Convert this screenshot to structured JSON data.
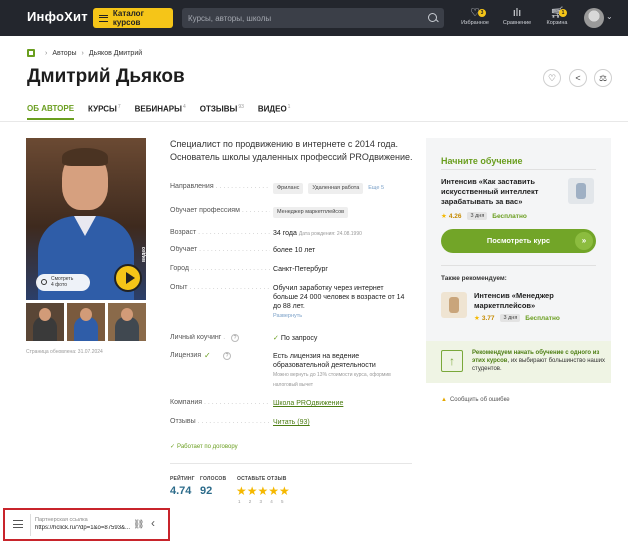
{
  "header": {
    "logo": "ИнфоХит",
    "catalog_label": "Каталог курсов",
    "search_placeholder": "Курсы, авторы, школы",
    "favorites": {
      "label": "Избранное",
      "count": "3"
    },
    "compare": {
      "label": "Сравнение"
    },
    "cart": {
      "label": "Корзина",
      "count": "1"
    }
  },
  "breadcrumb": {
    "items": [
      "Авторы",
      "Дьяков Дмитрий"
    ]
  },
  "page": {
    "title": "Дмитрий Дьяков",
    "tabs": [
      {
        "label": "ОБ АВТОРЕ",
        "count": ""
      },
      {
        "label": "КУРСЫ",
        "count": "7"
      },
      {
        "label": "ВЕБИНАРЫ",
        "count": "4"
      },
      {
        "label": "ОТЗЫВЫ",
        "count": "93"
      },
      {
        "label": "ВИДЕО",
        "count": "1"
      }
    ]
  },
  "profile": {
    "watch_photos": [
      "Смотреть",
      "4 фото"
    ],
    "video_label": "видео",
    "updated": "Страница обновлена: 31.07.2024",
    "intro": "Специалист по продвижению в интернете с 2014 года. Основатель школы удаленных профессий PROдвижение.",
    "fields": {
      "direction": {
        "label": "Направления",
        "chips": [
          "Фриланс",
          "Удаленная работа"
        ],
        "more": "Еще 5"
      },
      "teaches": {
        "label": "Обучает профессиям",
        "chips": [
          "Менеджер маркетплейсов"
        ]
      },
      "age": {
        "label": "Возраст",
        "value": "34 года",
        "note": "Дата рождения: 24.08.1990"
      },
      "teaching": {
        "label": "Обучает",
        "value": "более 10 лет"
      },
      "city": {
        "label": "Город",
        "value": "Санкт-Петербург"
      },
      "experience": {
        "label": "Опыт",
        "lines": [
          "Обучил заработку через интернет",
          "больше 24 000 человек в возрасте от 14",
          "до 88 лет."
        ],
        "expand": "Развернуть"
      },
      "coaching": {
        "label": "Личный коучинг",
        "q": "?",
        "value": "По запросу"
      },
      "license": {
        "label": "Лицензия",
        "q": "?",
        "lines": [
          "Есть лицензия на ведение",
          "образовательной деятельности"
        ],
        "notes": [
          "Можно вернуть до 13% стоимости курса, оформив",
          "налоговый вычет"
        ]
      },
      "company": {
        "label": "Компания",
        "value": "Школа PROдвижение"
      },
      "reviews": {
        "label": "Отзывы",
        "value": "Читать (93)"
      }
    },
    "contract": "Работает по договору",
    "stats": {
      "rating_label": "РЕЙТИНГ",
      "rating": "4.74",
      "votes_label": "ГОЛОСОВ",
      "votes": "92",
      "leave_label": "ОСТАВЬТЕ ОТЗЫВ",
      "stars": "★★★★★",
      "star_numbers": "1 2 3 4 5"
    }
  },
  "sidebar": {
    "heading": "Начните обучение",
    "course1": {
      "lines": [
        "Интенсив «Как заставить",
        "искусственный интеллект",
        "зарабатывать за вас»"
      ],
      "rating": "4.26",
      "duration": "3 дня",
      "price": "Бесплатно"
    },
    "cta": "Посмотреть курс",
    "also_label": "Также рекомендуем:",
    "course2": {
      "lines": [
        "Интенсив «Менеджер",
        "маркетплейсов»"
      ],
      "rating": "3.77",
      "duration": "3 дня",
      "price": "Бесплатно"
    },
    "promo": {
      "bold": "Рекомендуем начать обучение с одного из этих курсов",
      "rest": ", их выбирают большинство наших студентов."
    },
    "report": "Сообщить об ошибке"
  },
  "affiliate": {
    "label": "Партнерская ссылка",
    "url": "https://hclick.ru/?dp=1&o=87593&..."
  },
  "colors": {
    "accent": "#6a9e1f",
    "header_bg": "#23262d",
    "catalog": "#f5c518",
    "highlight_border": "#c8242b"
  }
}
